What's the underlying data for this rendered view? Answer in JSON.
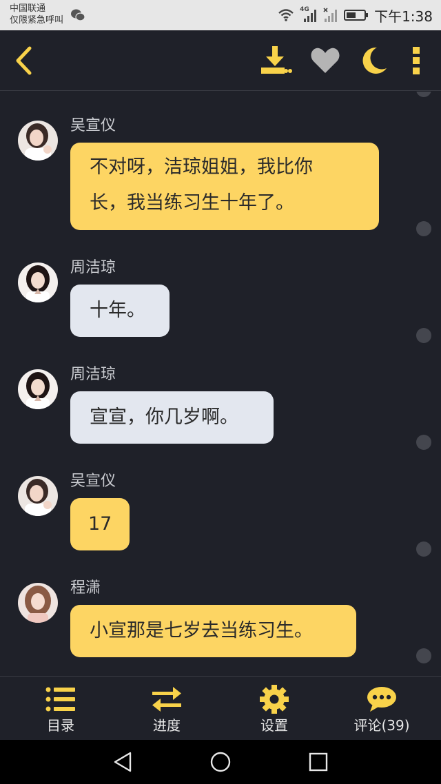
{
  "status_bar": {
    "carrier_line1": "中国联通",
    "carrier_line2": "仅限紧急呼叫",
    "network": "4G",
    "time": "下午1:38"
  },
  "top_bar": {
    "icons": [
      "back-icon",
      "download-icon",
      "heart-icon",
      "moon-icon",
      "more-icon"
    ],
    "accent_color": "#f8d24a",
    "heart_color": "#b4b4b4"
  },
  "messages": [
    {
      "sender": "吴宣仪",
      "text_lines": [
        "不对呀，洁琼姐姐，我比你",
        "长，我当练习生十年了。"
      ],
      "bubble_color": "#fdd563"
    },
    {
      "sender": "周洁琼",
      "text_lines": [
        "十年。"
      ],
      "bubble_color": "#e3e7ef"
    },
    {
      "sender": "周洁琼",
      "text_lines": [
        "宣宣，你几岁啊。"
      ],
      "bubble_color": "#e3e7ef"
    },
    {
      "sender": "吴宣仪",
      "text_lines": [
        "17"
      ],
      "bubble_color": "#fdd563"
    },
    {
      "sender": "程潇",
      "text_lines": [
        "小宣那是七岁去当练习生。"
      ],
      "bubble_color": "#fdd563"
    }
  ],
  "bottom_nav": {
    "items": [
      {
        "label": "目录",
        "icon": "list-icon"
      },
      {
        "label": "进度",
        "icon": "swap-arrows-icon"
      },
      {
        "label": "设置",
        "icon": "gear-icon"
      },
      {
        "label": "评论(39)",
        "icon": "chat-bubble-icon"
      }
    ]
  },
  "system_nav": {
    "icons": [
      "nav-back-icon",
      "nav-home-icon",
      "nav-recents-icon"
    ]
  }
}
